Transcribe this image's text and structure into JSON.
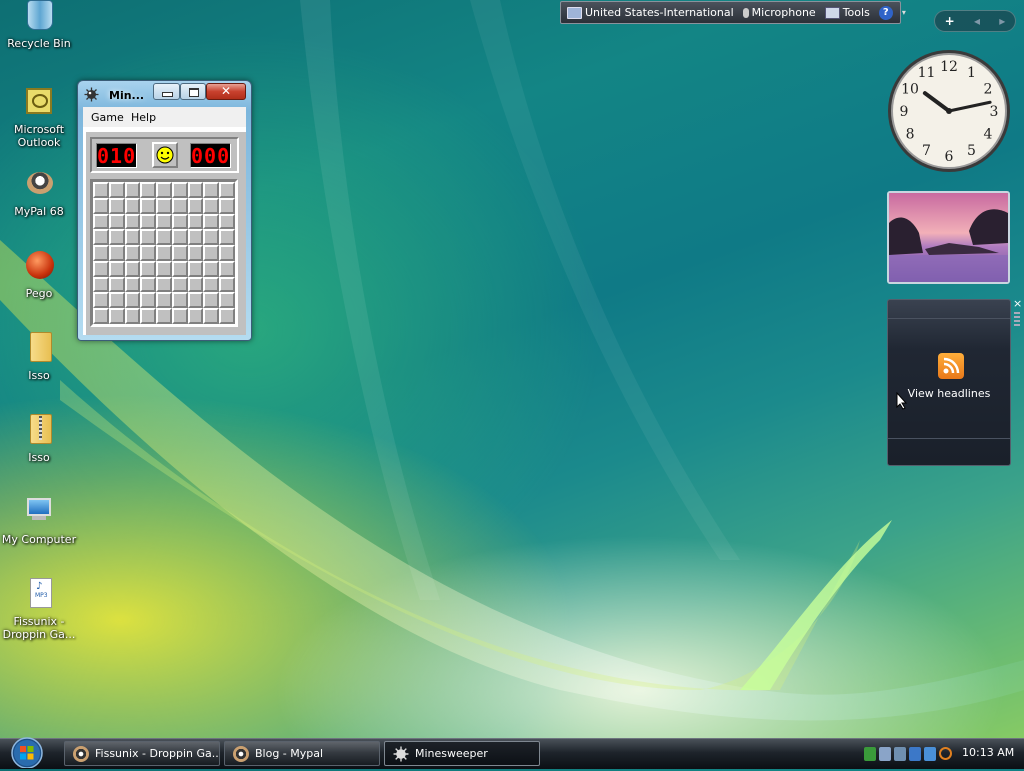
{
  "desktop": {
    "icons": [
      {
        "label": "Recycle Bin"
      },
      {
        "label": "Microsoft Outlook"
      },
      {
        "label": "MyPal 68"
      },
      {
        "label": "Pego"
      },
      {
        "label": "Isso"
      },
      {
        "label": "Isso"
      },
      {
        "label": "My Computer"
      },
      {
        "label": "Fissunix - Droppin Ga..."
      }
    ]
  },
  "language_bar": {
    "language": "United States-International",
    "microphone": "Microphone",
    "tools": "Tools",
    "help": "?"
  },
  "gadget_toolbar": {
    "add": "+",
    "prev": "◂",
    "next": "▸"
  },
  "clock_gadget": {
    "numbers": [
      "12",
      "1",
      "2",
      "3",
      "4",
      "5",
      "6",
      "7",
      "8",
      "9",
      "10",
      "11"
    ],
    "time": "10:13"
  },
  "feed_gadget": {
    "label": "View headlines",
    "close": "×"
  },
  "minesweeper": {
    "title": "Min...",
    "menu": {
      "game": "Game",
      "help": "Help"
    },
    "mines_counter": "010",
    "timer": "000",
    "rows": 9,
    "cols": 9
  },
  "taskbar": {
    "buttons": [
      {
        "label": "Fissunix - Droppin Ga...",
        "icon": "media-icon"
      },
      {
        "label": "Blog - Mypal",
        "icon": "mypal-icon"
      },
      {
        "label": "Minesweeper",
        "icon": "mine-icon",
        "active": true
      }
    ],
    "clock": "10:13 AM"
  },
  "colors": {
    "accent": "#138585",
    "mine_digit": "#ff0000"
  }
}
